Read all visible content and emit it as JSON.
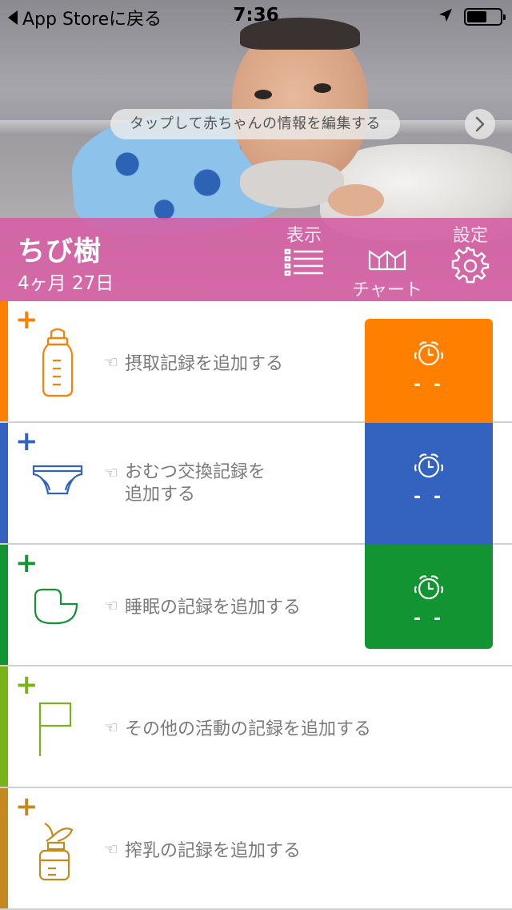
{
  "status_bar": {
    "back_label": "App Storeに戻る",
    "time": "7:36"
  },
  "hero": {
    "hint": "タップして赤ちゃんの情報を編集する"
  },
  "baby": {
    "name": "ちび樹",
    "age": "4ヶ月 27日"
  },
  "toolbar": {
    "display_label": "表示",
    "chart_label": "チャート",
    "settings_label": "設定"
  },
  "rows": [
    {
      "plus": "+",
      "action": "摂取記録を追加する",
      "color": "#ff7f00",
      "icon": "bottle-icon",
      "timer": "- -",
      "timer_color": "#ff7f00"
    },
    {
      "plus": "+",
      "action_line1": "おむつ交換記録を",
      "action_line2": "追加する",
      "color": "#3363bf",
      "icon": "diaper-icon",
      "timer": "- -",
      "timer_color": "#3363bf"
    },
    {
      "plus": "+",
      "action": "睡眠の記録を追加する",
      "color": "#139433",
      "icon": "crib-icon",
      "timer": "- -",
      "timer_color": "#139433"
    },
    {
      "plus": "+",
      "action": "その他の活動の記録を追加する",
      "color": "#7ab317",
      "icon": "flag-icon"
    },
    {
      "plus": "+",
      "action": "搾乳の記録を追加する",
      "color": "#c48a1f",
      "icon": "breast-pump-icon"
    }
  ]
}
